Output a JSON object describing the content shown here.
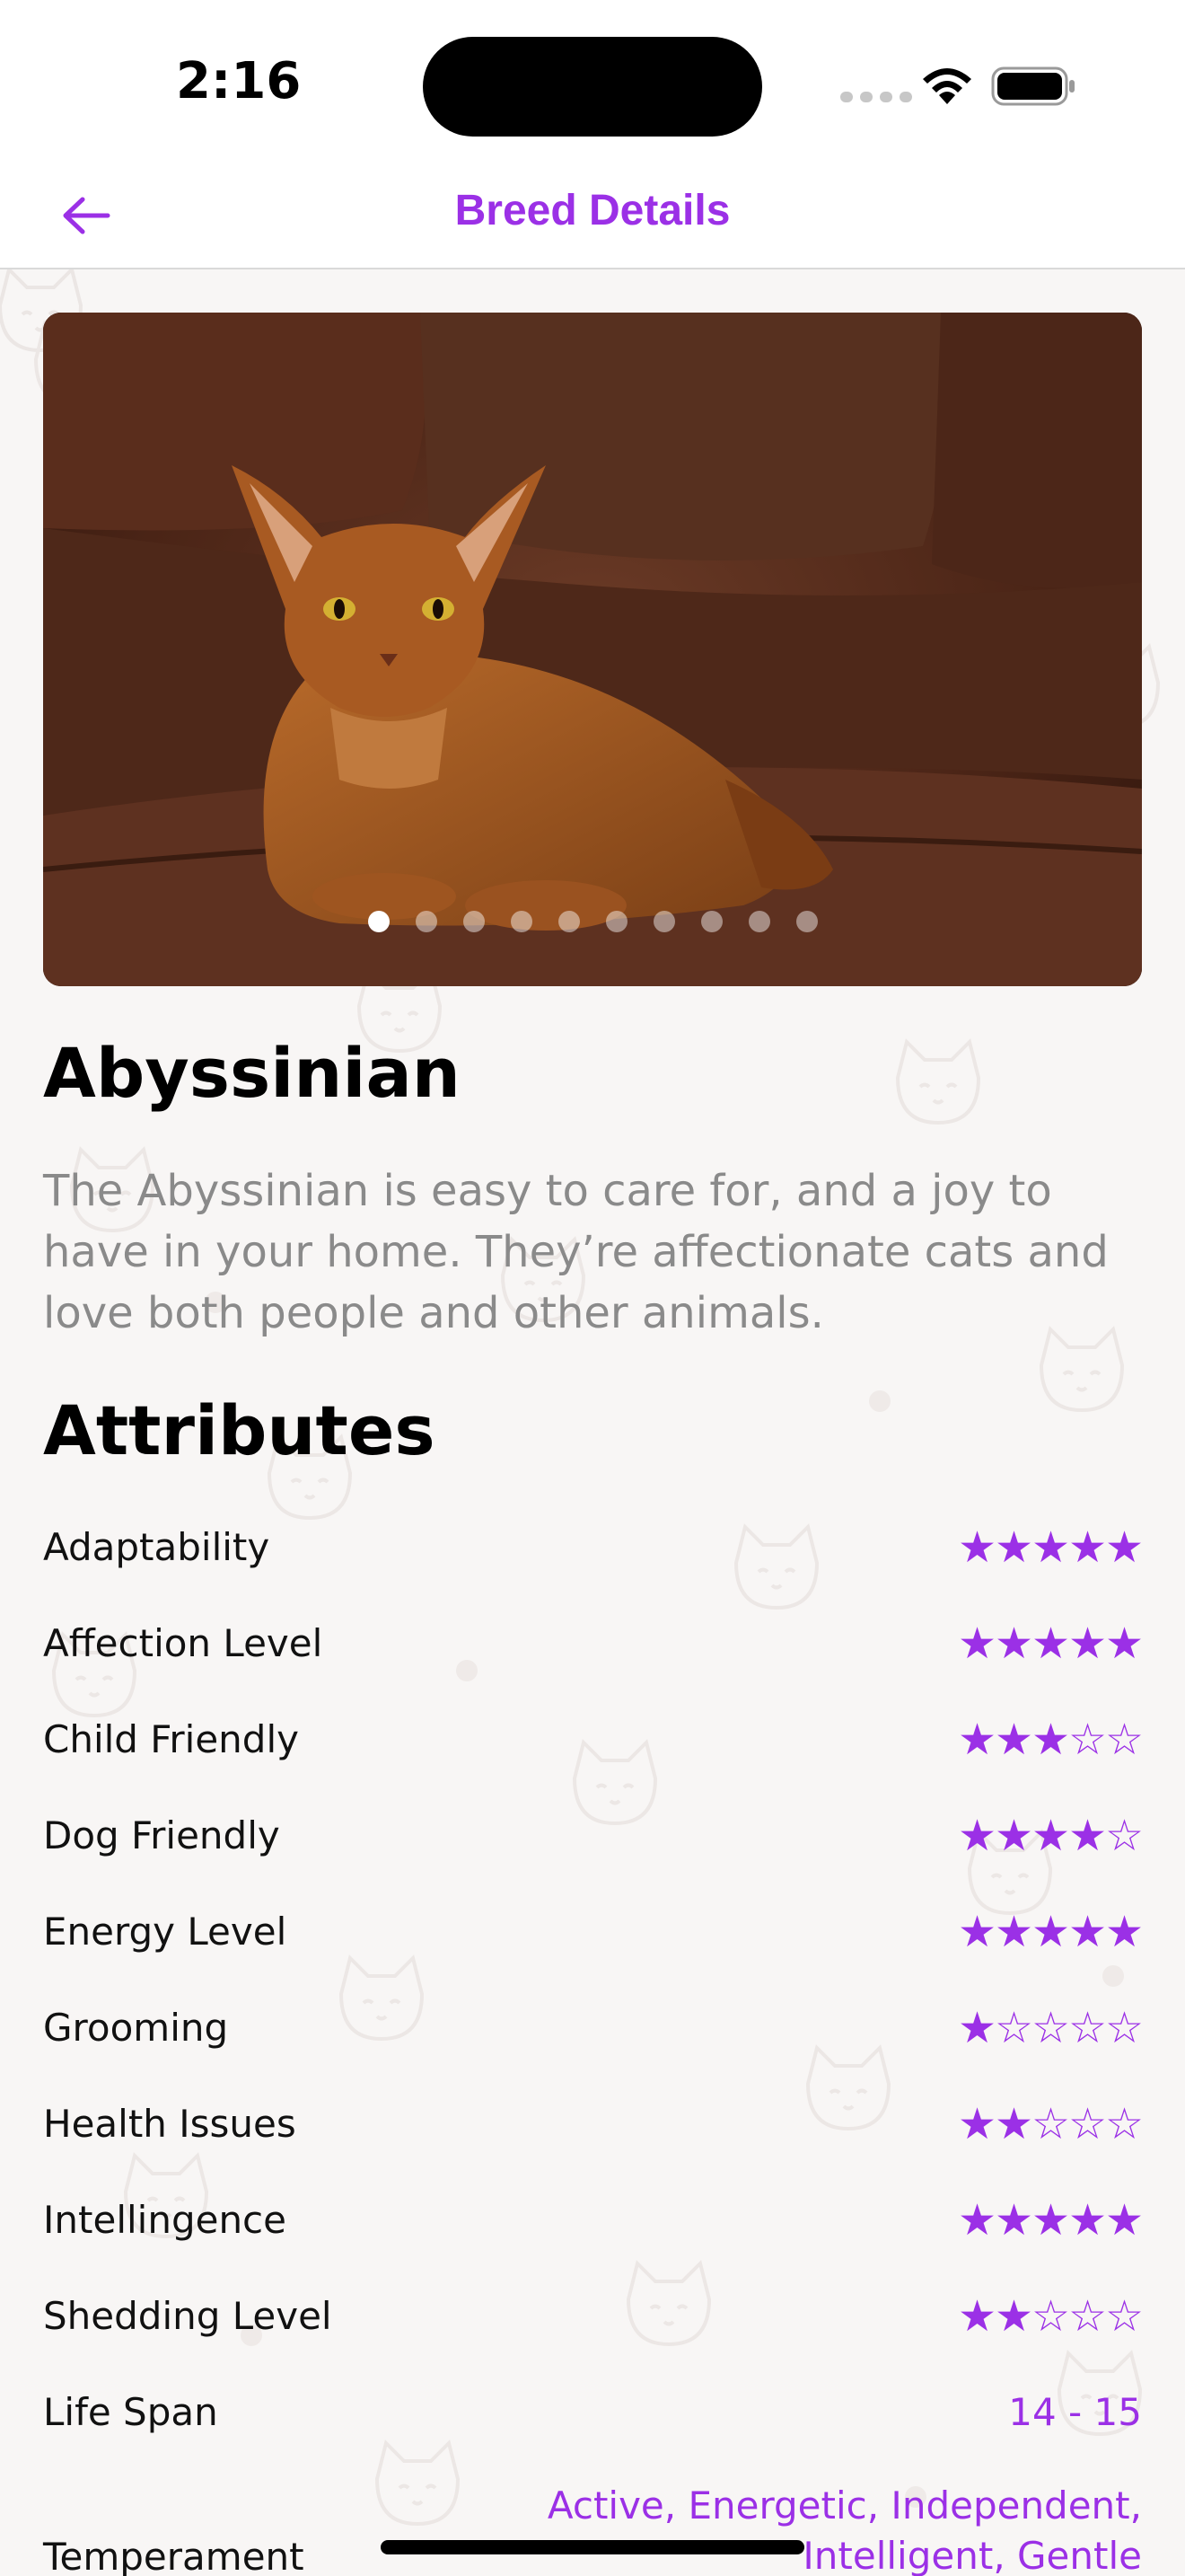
{
  "status_bar": {
    "time": "2:16"
  },
  "nav": {
    "title": "Breed Details",
    "back_icon": "arrow-left-icon"
  },
  "carousel": {
    "page_count": 10,
    "active_index": 0
  },
  "breed": {
    "name": "Abyssinian",
    "description": "The Abyssinian is easy to care for, and a joy to have in your home. They’re affectionate cats and love both people and other animals."
  },
  "attributes_title": "Attributes",
  "attributes": [
    {
      "label": "Adaptability",
      "rating": 5
    },
    {
      "label": "Affection Level",
      "rating": 5
    },
    {
      "label": "Child Friendly",
      "rating": 3
    },
    {
      "label": "Dog Friendly",
      "rating": 4
    },
    {
      "label": "Energy Level",
      "rating": 5
    },
    {
      "label": "Grooming",
      "rating": 1
    },
    {
      "label": "Health Issues",
      "rating": 2
    },
    {
      "label": "Intellingence",
      "rating": 5
    },
    {
      "label": "Shedding Level",
      "rating": 2
    }
  ],
  "life_span": {
    "label": "Life Span",
    "value": "14 - 15"
  },
  "temperament": {
    "label": "Temperament",
    "value": "Active, Energetic, Independent, Intelligent, Gentle"
  },
  "colors": {
    "accent": "#9b30e6",
    "description_text": "#8a8a8a"
  }
}
